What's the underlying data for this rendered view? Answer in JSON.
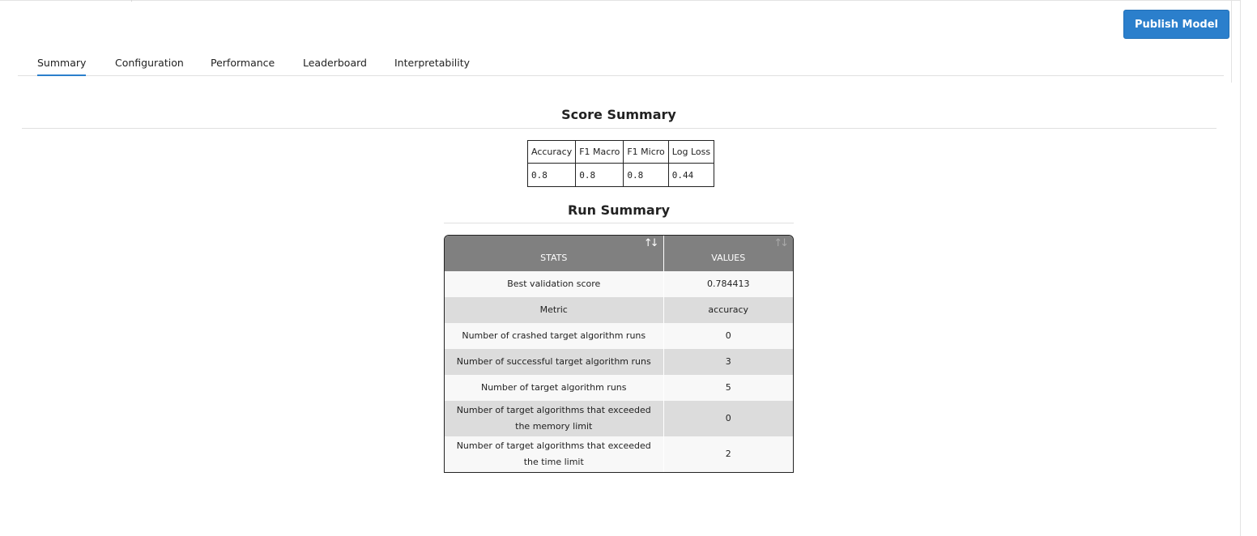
{
  "header": {
    "publish_label": "Publish Model"
  },
  "tabs": [
    {
      "label": "Summary",
      "active": true
    },
    {
      "label": "Configuration",
      "active": false
    },
    {
      "label": "Performance",
      "active": false
    },
    {
      "label": "Leaderboard",
      "active": false
    },
    {
      "label": "Interpretability",
      "active": false
    }
  ],
  "score_summary": {
    "title": "Score Summary",
    "headers": [
      "Accuracy",
      "F1 Macro",
      "F1 Micro",
      "Log Loss"
    ],
    "values": [
      "0.8",
      "0.8",
      "0.8",
      "0.44"
    ]
  },
  "run_summary": {
    "title": "Run Summary",
    "columns": [
      "STATS",
      "VALUES"
    ],
    "sort_icon": "sort-up-down-icon",
    "rows": [
      {
        "stat": "Best validation score",
        "value": "0.784413"
      },
      {
        "stat": "Metric",
        "value": "accuracy"
      },
      {
        "stat": "Number of crashed target algorithm runs",
        "value": "0"
      },
      {
        "stat": "Number of successful target algorithm runs",
        "value": "3"
      },
      {
        "stat": "Number of target algorithm runs",
        "value": "5"
      },
      {
        "stat": "Number of target algorithms that exceeded the memory limit",
        "value": "0"
      },
      {
        "stat": "Number of target algorithms that exceeded the time limit",
        "value": "2"
      }
    ]
  },
  "colors": {
    "accent": "#2b7fcc",
    "table_header": "#808080"
  }
}
